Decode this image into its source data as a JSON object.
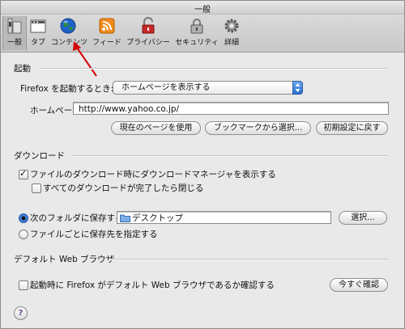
{
  "window": {
    "title": "一般"
  },
  "toolbar": {
    "items": [
      {
        "label": "一般",
        "icon": "general-switch-icon"
      },
      {
        "label": "タブ",
        "icon": "tabs-icon"
      },
      {
        "label": "コンテンツ",
        "icon": "globe-icon"
      },
      {
        "label": "フィード",
        "icon": "rss-feed-icon"
      },
      {
        "label": "プライバシー",
        "icon": "privacy-lock-icon"
      },
      {
        "label": "セキュリティ",
        "icon": "security-lock-icon"
      },
      {
        "label": "詳細",
        "icon": "advanced-gear-icon"
      }
    ]
  },
  "startup": {
    "section_title": "起動",
    "when_label": "Firefox を起動するとき:",
    "when_value": "ホームページを表示する",
    "homepage_label": "ホームページ:",
    "homepage_value": "http://www.yahoo.co.jp/",
    "use_current_label": "現在のページを使用",
    "use_bookmark_label": "ブックマークから選択...",
    "restore_default_label": "初期設定に戻す"
  },
  "downloads": {
    "section_title": "ダウンロード",
    "show_manager_label": "ファイルのダウンロード時にダウンロードマネージャを表示する",
    "show_manager_checked": true,
    "close_when_done_label": "すべてのダウンロードが完了したら閉じる",
    "close_when_done_checked": false,
    "save_to_label": "次のフォルダに保存する",
    "save_to_selected": true,
    "folder_value": "デスクトップ",
    "choose_label": "選択...",
    "ask_label": "ファイルごとに保存先を指定する",
    "ask_selected": false
  },
  "default_browser": {
    "section_title": "デフォルト Web ブラウザ",
    "check_label": "起動時に Firefox がデフォルト Web ブラウザであるか確認する",
    "check_checked": false,
    "check_now_label": "今すぐ確認"
  },
  "help": {
    "label": "?"
  },
  "colors": {
    "accent": "#2b6fd0",
    "arrow": "#d40000"
  }
}
